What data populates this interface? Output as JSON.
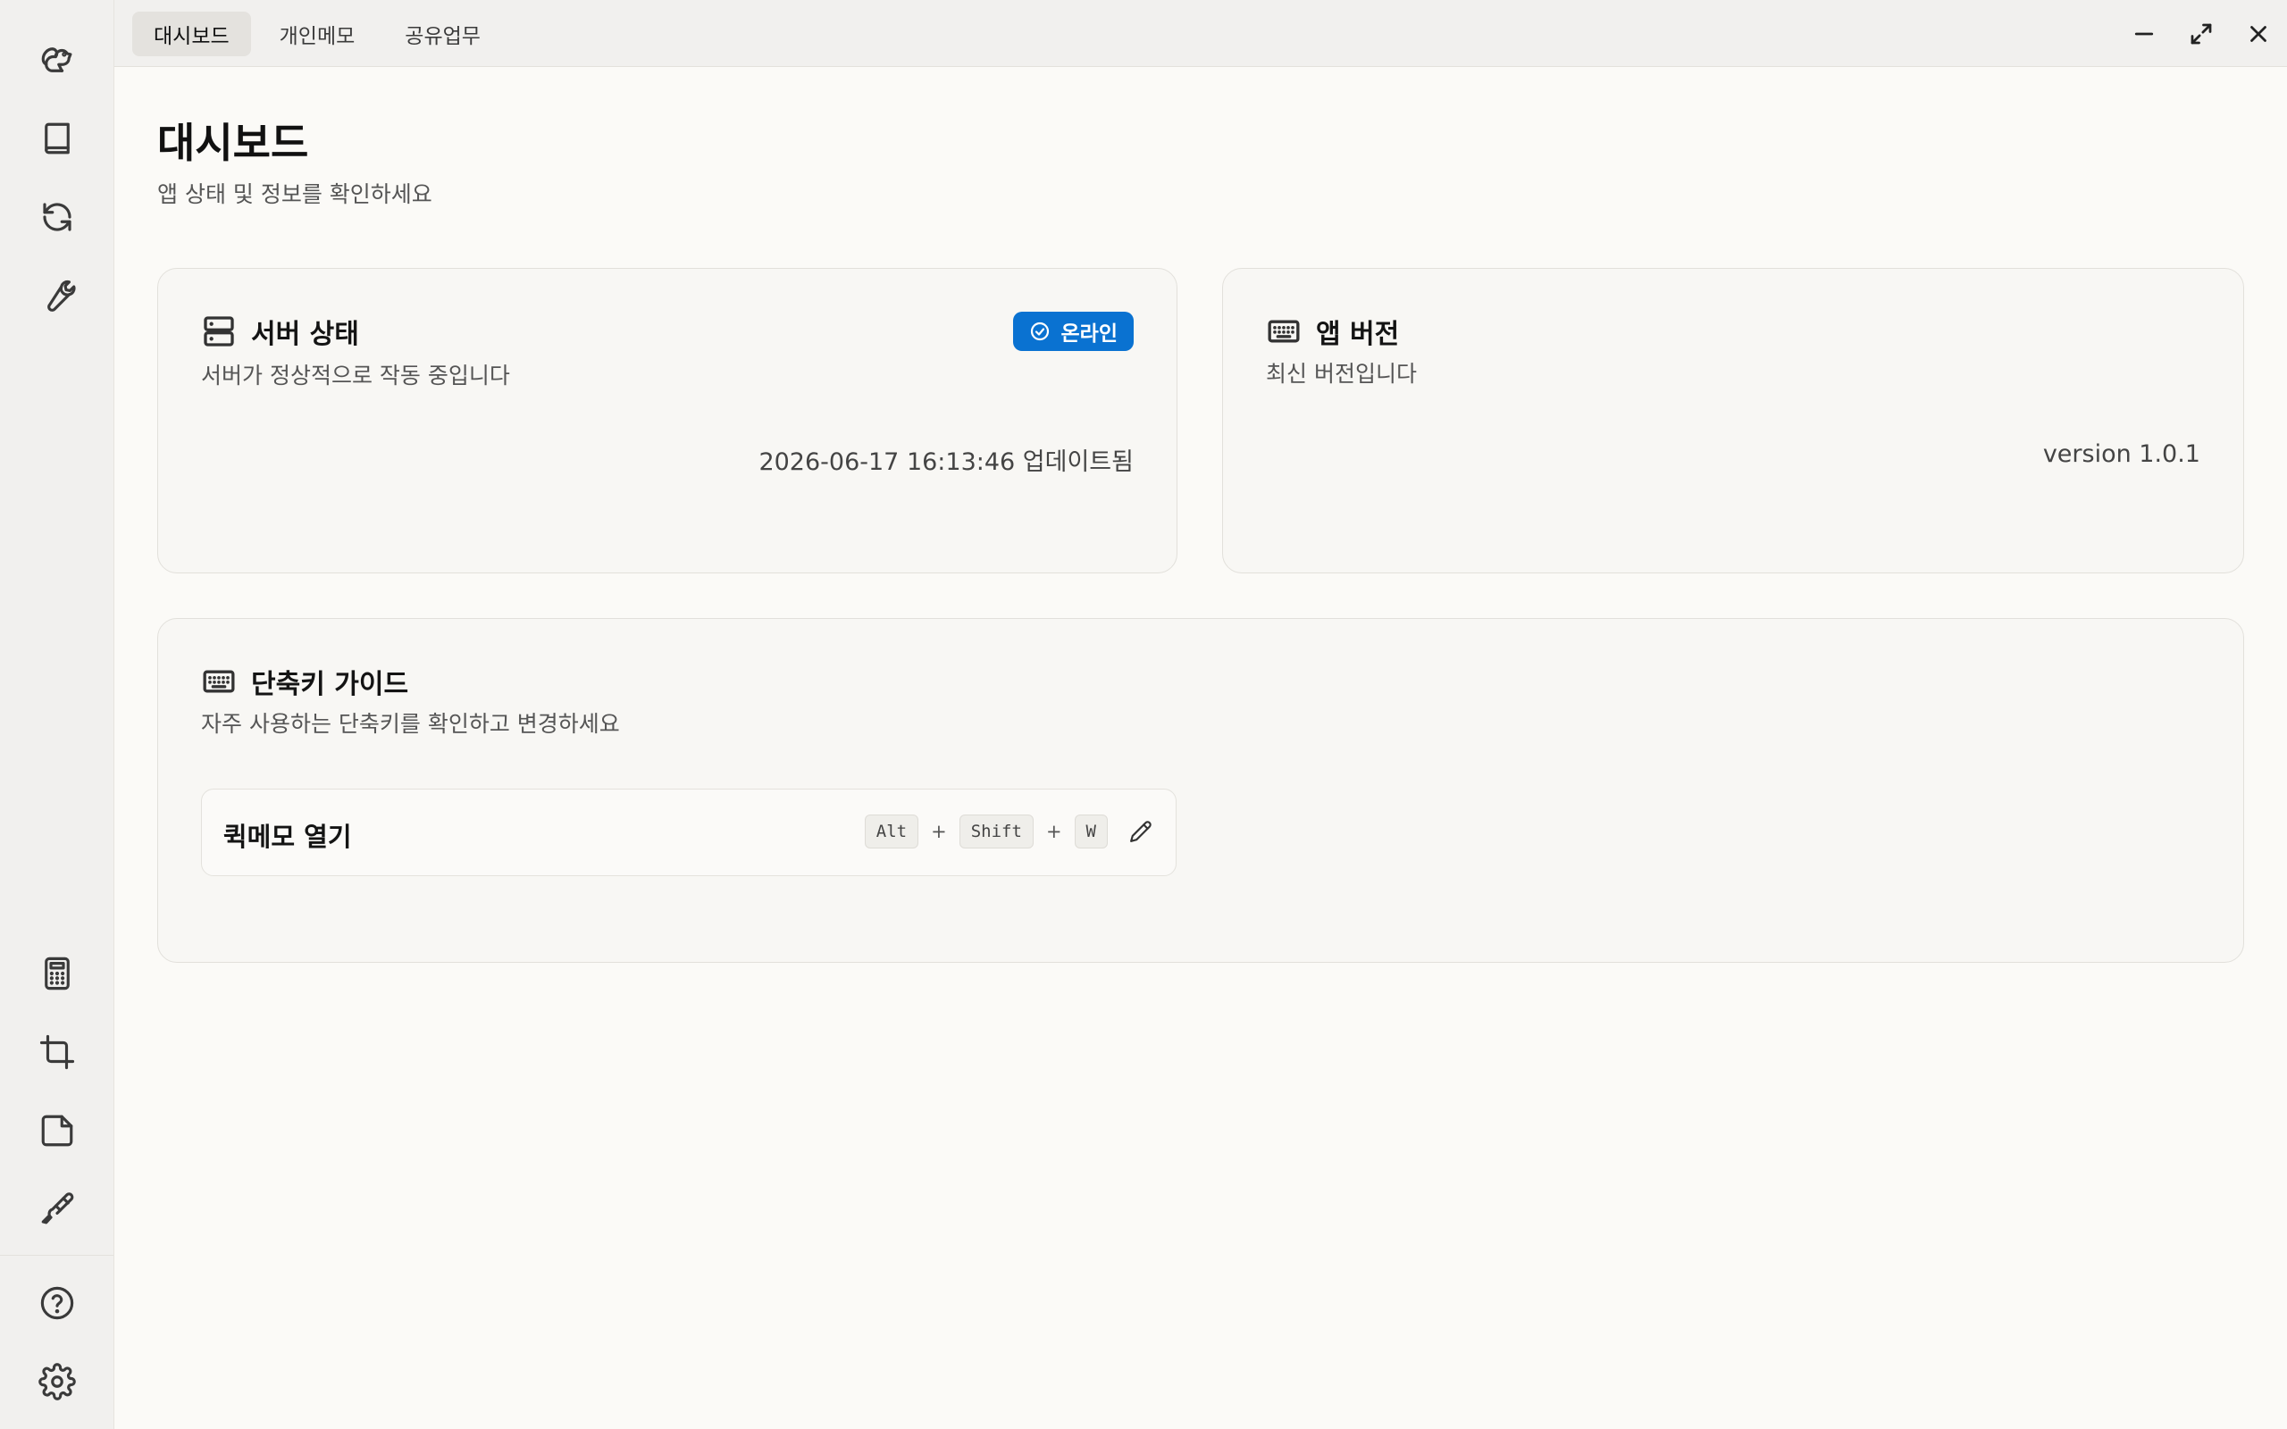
{
  "tabs": [
    {
      "label": "대시보드",
      "active": true
    },
    {
      "label": "개인메모",
      "active": false
    },
    {
      "label": "공유업무",
      "active": false
    }
  ],
  "sidebar": {
    "top_icons": [
      "squirrel-icon",
      "book-icon",
      "refresh-icon",
      "wrench-icon"
    ],
    "bottom_icons": [
      "calculator-icon",
      "crop-icon",
      "sticky-note-icon",
      "paintbrush-icon"
    ],
    "footer_icons": [
      "help-icon",
      "settings-icon"
    ]
  },
  "window_controls": [
    "minimize-icon",
    "maximize-icon",
    "close-icon"
  ],
  "page": {
    "title": "대시보드",
    "subtitle": "앱 상태 및 정보를 확인하세요"
  },
  "server_card": {
    "icon": "server-icon",
    "title": "서버 상태",
    "description": "서버가 정상적으로 작동 중입니다",
    "badge": "온라인",
    "badge_color": "#0a72d1",
    "updated": "2026-06-17 16:13:46 업데이트됨"
  },
  "version_card": {
    "icon": "keyboard-icon",
    "title": "앱 버전",
    "description": "최신 버전입니다",
    "version": "version 1.0.1"
  },
  "shortcut_card": {
    "icon": "keyboard-icon",
    "title": "단축키 가이드",
    "description": "자주 사용하는 단축키를 확인하고 변경하세요",
    "items": [
      {
        "label": "퀵메모 열기",
        "keys": [
          "Alt",
          "Shift",
          "W"
        ],
        "separator": "+"
      }
    ]
  }
}
